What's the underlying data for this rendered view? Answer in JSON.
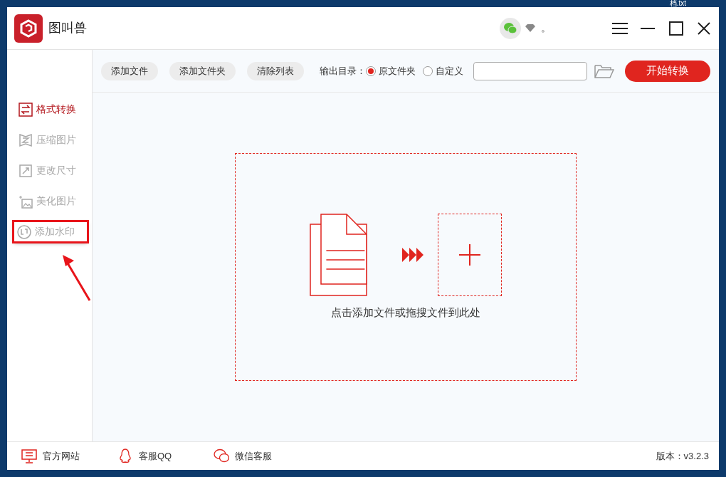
{
  "desktop_label": "档.txt",
  "window": {
    "app_name": "图叫兽",
    "header_mark": "。"
  },
  "sidebar": {
    "items": [
      {
        "label": "格式转换",
        "kind": "convert",
        "selected": true,
        "highlighted": false
      },
      {
        "label": "压缩图片",
        "kind": "compress",
        "selected": false,
        "highlighted": false
      },
      {
        "label": "更改尺寸",
        "kind": "resize",
        "selected": false,
        "highlighted": false
      },
      {
        "label": "美化图片",
        "kind": "beautify",
        "selected": false,
        "highlighted": false
      },
      {
        "label": "添加水印",
        "kind": "watermark",
        "selected": false,
        "highlighted": true
      }
    ]
  },
  "toolbar": {
    "buttons": [
      "添加文件",
      "添加文件夹",
      "清除列表"
    ],
    "output_label": "输出目录：",
    "output_options": [
      {
        "label": "原文件夹",
        "selected": true
      },
      {
        "label": "自定义",
        "selected": false
      }
    ],
    "start_button": "开始转换"
  },
  "drop_zone": {
    "hint": "点击添加文件或拖搜文件到此处"
  },
  "footer": {
    "links": [
      {
        "label": "官方网站",
        "kind": "website"
      },
      {
        "label": "客服QQ",
        "kind": "qq"
      },
      {
        "label": "微信客服",
        "kind": "wechat"
      }
    ],
    "version": "版本：v3.2.3"
  }
}
